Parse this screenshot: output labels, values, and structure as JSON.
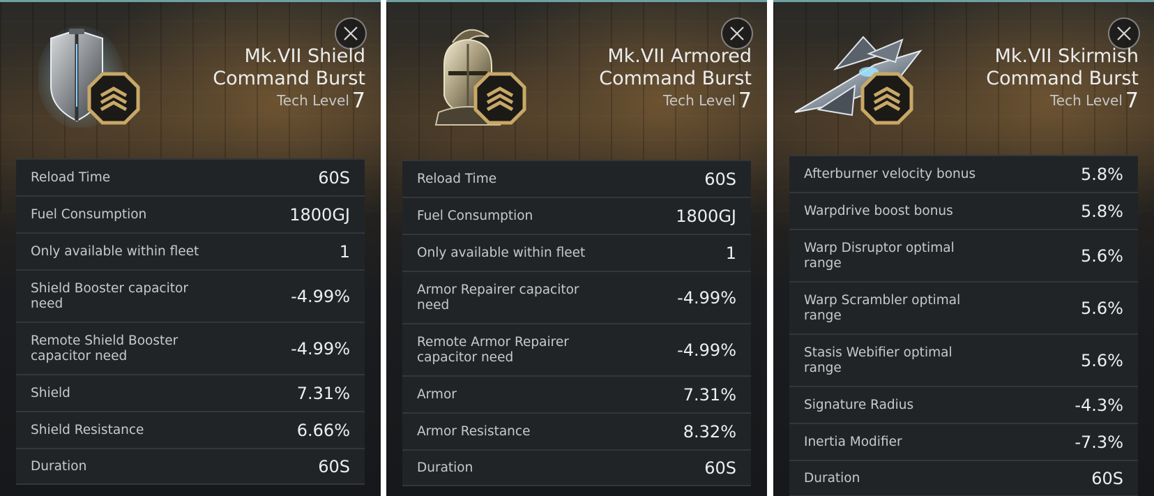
{
  "panels": [
    {
      "title": "Mk.VII Shield Command Burst",
      "tech_label": "Tech Level",
      "tech_level": "7",
      "icon": "shield-icon",
      "stats": [
        {
          "label": "Reload Time",
          "value": "60S"
        },
        {
          "label": "Fuel Consumption",
          "value": "1800GJ"
        },
        {
          "label": "Only available within fleet",
          "value": "1"
        },
        {
          "label": "Shield Booster capacitor need",
          "value": "-4.99%"
        },
        {
          "label": "Remote Shield Booster capacitor need",
          "value": "-4.99%"
        },
        {
          "label": "Shield",
          "value": "7.31%"
        },
        {
          "label": "Shield Resistance",
          "value": "6.66%"
        },
        {
          "label": "Duration",
          "value": "60S"
        }
      ]
    },
    {
      "title": "Mk.VII Armored Command Burst",
      "tech_label": "Tech Level",
      "tech_level": "7",
      "icon": "knight-helmet-icon",
      "stats": [
        {
          "label": "Reload Time",
          "value": "60S"
        },
        {
          "label": "Fuel Consumption",
          "value": "1800GJ"
        },
        {
          "label": "Only available within fleet",
          "value": "1"
        },
        {
          "label": "Armor Repairer capacitor need",
          "value": "-4.99%"
        },
        {
          "label": "Remote Armor Repairer capacitor need",
          "value": "-4.99%"
        },
        {
          "label": "Armor",
          "value": "7.31%"
        },
        {
          "label": "Armor Resistance",
          "value": "8.32%"
        },
        {
          "label": "Duration",
          "value": "60S"
        }
      ]
    },
    {
      "title": "Mk.VII Skirmish Command Burst",
      "tech_label": "Tech Level",
      "tech_level": "7",
      "icon": "starship-icon",
      "stats": [
        {
          "label": "Afterburner velocity bonus",
          "value": "5.8%"
        },
        {
          "label": "Warpdrive boost bonus",
          "value": "5.8%"
        },
        {
          "label": "Warp Disruptor optimal range",
          "value": "5.6%"
        },
        {
          "label": "Warp Scrambler optimal range",
          "value": "5.6%"
        },
        {
          "label": "Stasis Webifier optimal range",
          "value": "5.6%"
        },
        {
          "label": "Signature Radius",
          "value": "-4.3%"
        },
        {
          "label": "Inertia Modifier",
          "value": "-7.3%"
        },
        {
          "label": "Duration",
          "value": "60S"
        }
      ]
    }
  ],
  "colors": {
    "accent_border": "#6fa1a2",
    "badge_gold": "#c8a867",
    "row_bg": "#212427"
  }
}
